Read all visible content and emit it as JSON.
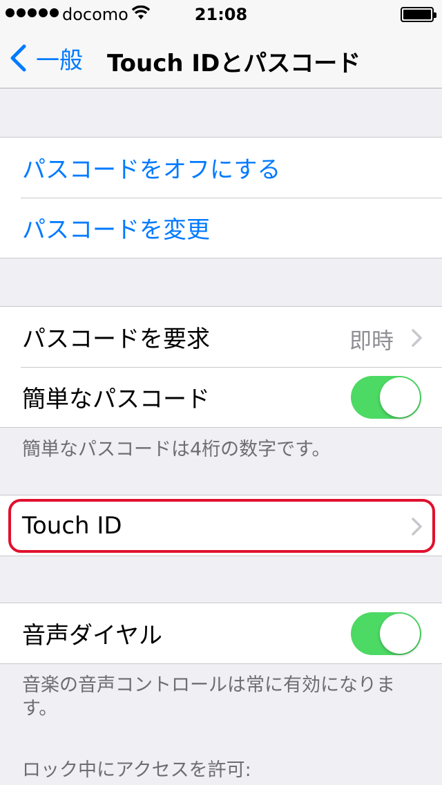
{
  "status_bar": {
    "carrier": "docomo",
    "time": "21:08"
  },
  "nav": {
    "back_label": "一般",
    "title": "Touch IDとパスコード"
  },
  "passcode_group": {
    "turn_off": "パスコードをオフにする",
    "change": "パスコードを変更"
  },
  "settings_group": {
    "require_label": "パスコードを要求",
    "require_value": "即時",
    "simple_label": "簡単なパスコード",
    "simple_on": true,
    "simple_footer": "簡単なパスコードは4桁の数字です。"
  },
  "touch_id": {
    "label": "Touch ID"
  },
  "voice_group": {
    "voice_dial_label": "音声ダイヤル",
    "voice_dial_on": true,
    "voice_footer": "音楽の音声コントロールは常に有効になります。"
  },
  "lock_section": {
    "header": "ロック中にアクセスを許可:"
  },
  "colors": {
    "accent": "#007aff",
    "toggle_on": "#4cd964",
    "highlight": "#e0102e",
    "background": "#efeff4"
  }
}
